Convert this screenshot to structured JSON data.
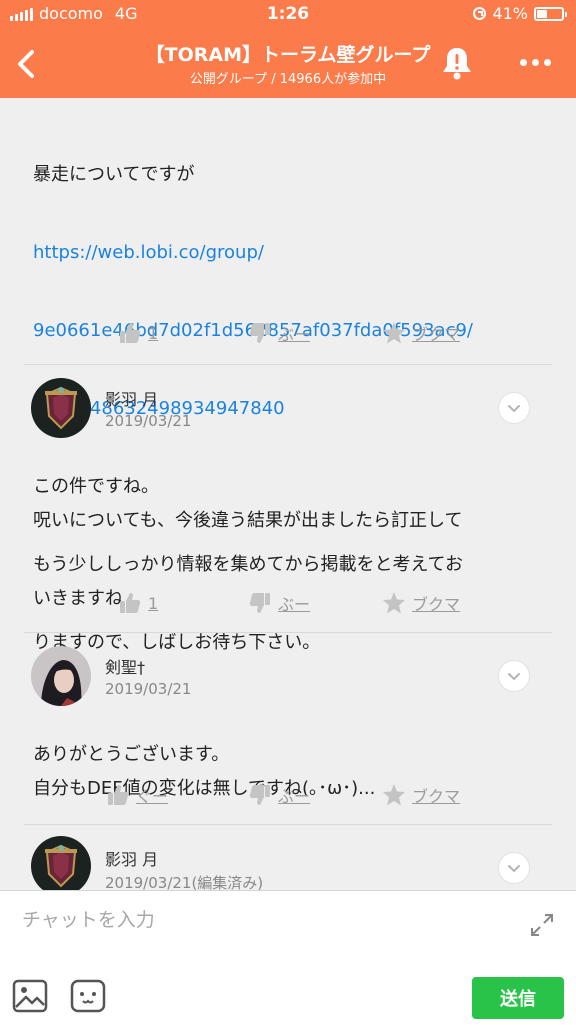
{
  "status_bar": {
    "carrier": "docomo",
    "network": "4G",
    "time": "1:26",
    "battery": "41%",
    "battery_level": 0.41
  },
  "header": {
    "title": "【TORAM】トーラム壁グループ",
    "subtitle": "公開グループ / 14966人が参加中",
    "back_icon": "chevron-left-icon",
    "alert_icon": "bell-alert-icon",
    "menu_icon": "more-dots-icon"
  },
  "messages": [
    {
      "text_lines": [
        "暴走についてですが"
      ],
      "link_lines": [
        "https://web.lobi.co/group/",
        "9e0661e46bd7d02f1d562857af037fda0f593ac9/",
        "chat/548632498934947840"
      ],
      "after_lines": [
        "この件ですね。",
        "もう少ししっかり情報を集めてから掲載をと考えてお",
        "りますので、しばしお待ち下さい。"
      ],
      "actions": {
        "like": "1",
        "dislike": "ぶー",
        "bookmark": "ブクマ"
      }
    },
    {
      "user": "影羽 月",
      "date": "2019/03/21",
      "text_lines": [
        "呪いについても、今後違う結果が出ましたら訂正して",
        "いきますね",
        "",
        "ありがとうございます。"
      ],
      "actions": {
        "like": "1",
        "dislike": "ぶー",
        "bookmark": "ブクマ"
      }
    },
    {
      "user": "剣聖†",
      "date": "2019/03/21",
      "text_lines": [
        "自分もDEF値の変化は無しですね(｡･ω･)..."
      ],
      "actions": {
        "like": "ぐー",
        "dislike": "ぶー",
        "bookmark": "ブクマ"
      }
    },
    {
      "user": "影羽 月",
      "date": "2019/03/21(編集済み)"
    }
  ],
  "composer": {
    "placeholder": "チャットを入力",
    "send_label": "送信"
  },
  "colors": {
    "header_bg": "#fc7b4a",
    "link": "#1a83e0",
    "send_button": "#29c34a",
    "action_gray": "#9b9b9b"
  }
}
